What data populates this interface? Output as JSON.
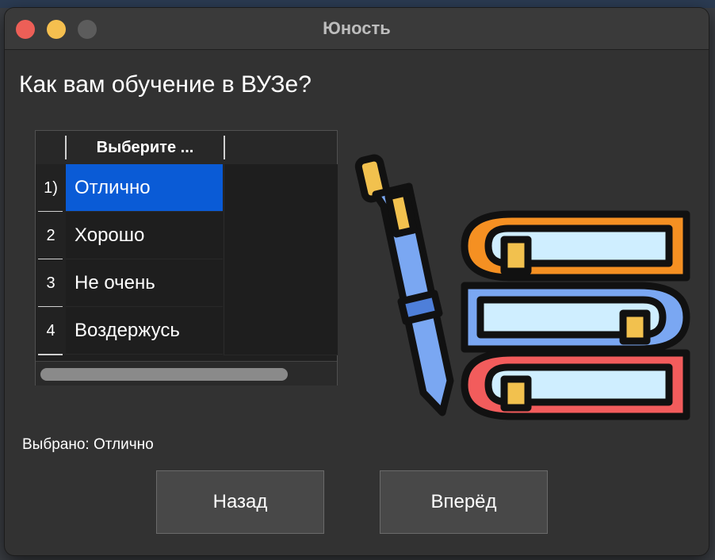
{
  "window": {
    "title": "Юность",
    "traffic_lights": {
      "close": "#ed5f57",
      "minimize": "#f5bf4f",
      "maximize": "#5c5c5c"
    }
  },
  "question": "Как вам обучение в ВУЗе?",
  "table": {
    "header": "Выберите ...",
    "rows": [
      {
        "num": "1)",
        "label": "Отлично",
        "selected": true
      },
      {
        "num": "2",
        "label": "Хорошо",
        "selected": false
      },
      {
        "num": "3",
        "label": "Не очень",
        "selected": false
      },
      {
        "num": "4",
        "label": "Воздержусь",
        "selected": false
      }
    ],
    "selection_color": "#0a5bd6"
  },
  "illustration": {
    "icons": [
      "pen-icon",
      "books-stack-icon"
    ]
  },
  "status": "Выбрано: Отлично",
  "buttons": {
    "back": "Назад",
    "next": "Вперёд"
  }
}
